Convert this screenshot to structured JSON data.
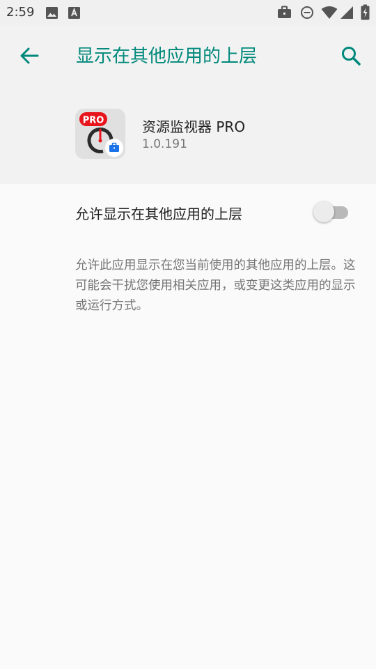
{
  "status_bar": {
    "time": "2:59",
    "left_icons": [
      "image-icon",
      "text-a-icon"
    ],
    "right_icons": [
      "briefcase-icon",
      "do-not-disturb-icon",
      "wifi-icon",
      "signal-icon",
      "battery-charging-icon"
    ]
  },
  "app_bar": {
    "title": "显示在其他应用的上层",
    "back_icon": "arrow-back-icon",
    "search_icon": "search-icon"
  },
  "app_info": {
    "name": "资源监视器 PRO",
    "version": "1.0.191",
    "badge": "PRO"
  },
  "setting": {
    "label": "允许显示在其他应用的上层",
    "enabled": false
  },
  "description": "允许此应用显示在您当前使用的其他应用的上层。这可能会干扰您使用相关应用，或变更这类应用的显示或运行方式。",
  "colors": {
    "accent": "#00897b",
    "badge_red": "#e8141c",
    "work_badge_blue": "#1a73e8"
  }
}
